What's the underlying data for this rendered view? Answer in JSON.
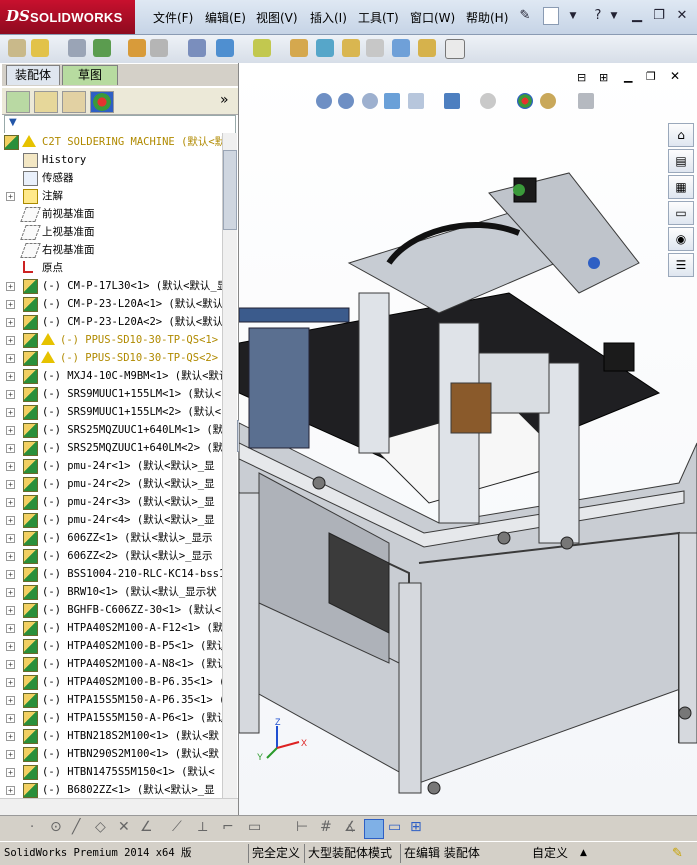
{
  "app": {
    "logo_ds": "DS",
    "logo_name": "SOLIDWORKS",
    "menu": [
      "文件(F)",
      "编辑(E)",
      "视图(V)",
      "插入(I)",
      "工具(T)",
      "窗口(W)",
      "帮助(H)"
    ],
    "help_symbol": "?"
  },
  "panel": {
    "tabs": [
      "装配体",
      "草图"
    ],
    "expand_symbol": "»",
    "filter_symbol": "▼"
  },
  "tree": {
    "root": "C2T SOLDERING MACHINE  (默认<默",
    "items": [
      {
        "label": "History",
        "type": "history"
      },
      {
        "label": "传感器",
        "type": "sensor"
      },
      {
        "label": "注解",
        "type": "annotation",
        "expandable": true
      },
      {
        "label": "前视基准面",
        "type": "plane"
      },
      {
        "label": "上视基准面",
        "type": "plane"
      },
      {
        "label": "右视基准面",
        "type": "plane"
      },
      {
        "label": "原点",
        "type": "origin"
      },
      {
        "label": "(-) CM-P-17L30<1> (默认<默认_显",
        "type": "part"
      },
      {
        "label": "(-) CM-P-23-L20A<1> (默认<默认",
        "type": "part"
      },
      {
        "label": "(-) CM-P-23-L20A<2> (默认<默认",
        "type": "part"
      },
      {
        "label": "(-) PPUS-SD10-30-TP-QS<1> (",
        "type": "part",
        "warning": true
      },
      {
        "label": "(-) PPUS-SD10-30-TP-QS<2> (",
        "type": "part",
        "warning": true
      },
      {
        "label": "(-) MXJ4-10C-M9BM<1> (默认<默认",
        "type": "part"
      },
      {
        "label": "(-) SRS9MUUC1+155LM<1> (默认<",
        "type": "part"
      },
      {
        "label": "(-) SRS9MUUC1+155LM<2> (默认<",
        "type": "part"
      },
      {
        "label": "(-) SRS25MQZUUC1+640LM<1> (默",
        "type": "part"
      },
      {
        "label": "(-) SRS25MQZUUC1+640LM<2> (默",
        "type": "part"
      },
      {
        "label": "(-) pmu-24r<1> (默认<默认>_显",
        "type": "part"
      },
      {
        "label": "(-) pmu-24r<2> (默认<默认>_显",
        "type": "part"
      },
      {
        "label": "(-) pmu-24r<3> (默认<默认>_显",
        "type": "part"
      },
      {
        "label": "(-) pmu-24r<4> (默认<默认>_显",
        "type": "part"
      },
      {
        "label": "(-) 606ZZ<1> (默认<默认>_显示",
        "type": "part"
      },
      {
        "label": "(-) 606ZZ<2> (默认<默认>_显示",
        "type": "part"
      },
      {
        "label": "(-) BSS1004-210-RLC-KC14-bss1",
        "type": "part"
      },
      {
        "label": "(-) BRW10<1> (默认<默认_显示状",
        "type": "part"
      },
      {
        "label": "(-) BGHFB-C606ZZ-30<1> (默认<",
        "type": "part"
      },
      {
        "label": "(-) HTPA40S2M100-A-F12<1> (默",
        "type": "part"
      },
      {
        "label": "(-) HTPA40S2M100-B-P5<1> (默认",
        "type": "part"
      },
      {
        "label": "(-) HTPA40S2M100-A-N8<1> (默认",
        "type": "part"
      },
      {
        "label": "(-) HTPA40S2M100-B-P6.35<1> (",
        "type": "part"
      },
      {
        "label": "(-) HTPA15S5M150-A-P6.35<1> (",
        "type": "part"
      },
      {
        "label": "(-) HTPA15S5M150-A-P6<1> (默认",
        "type": "part"
      },
      {
        "label": "(-) HTBN218S2M100<1> (默认<默",
        "type": "part"
      },
      {
        "label": "(-) HTBN290S2M100<1> (默认<默",
        "type": "part"
      },
      {
        "label": "(-) HTBN1475S5M150<1> (默认<",
        "type": "part"
      },
      {
        "label": "(-) B6802ZZ<1> (默认<默认>_显",
        "type": "part"
      }
    ]
  },
  "triad": {
    "x": "X",
    "y": "Y",
    "z": "Z"
  },
  "status": {
    "product": "SolidWorks Premium 2014 x64 版",
    "state1": "完全定义",
    "state2": "大型装配体模式",
    "state3": "在编辑 装配体",
    "units": "自定义"
  },
  "colors": {
    "brand": "#c8102e",
    "frame": "#c9cdd3",
    "frame_edge": "#3a3a3a",
    "accent_blue": "#3b5b8c"
  }
}
